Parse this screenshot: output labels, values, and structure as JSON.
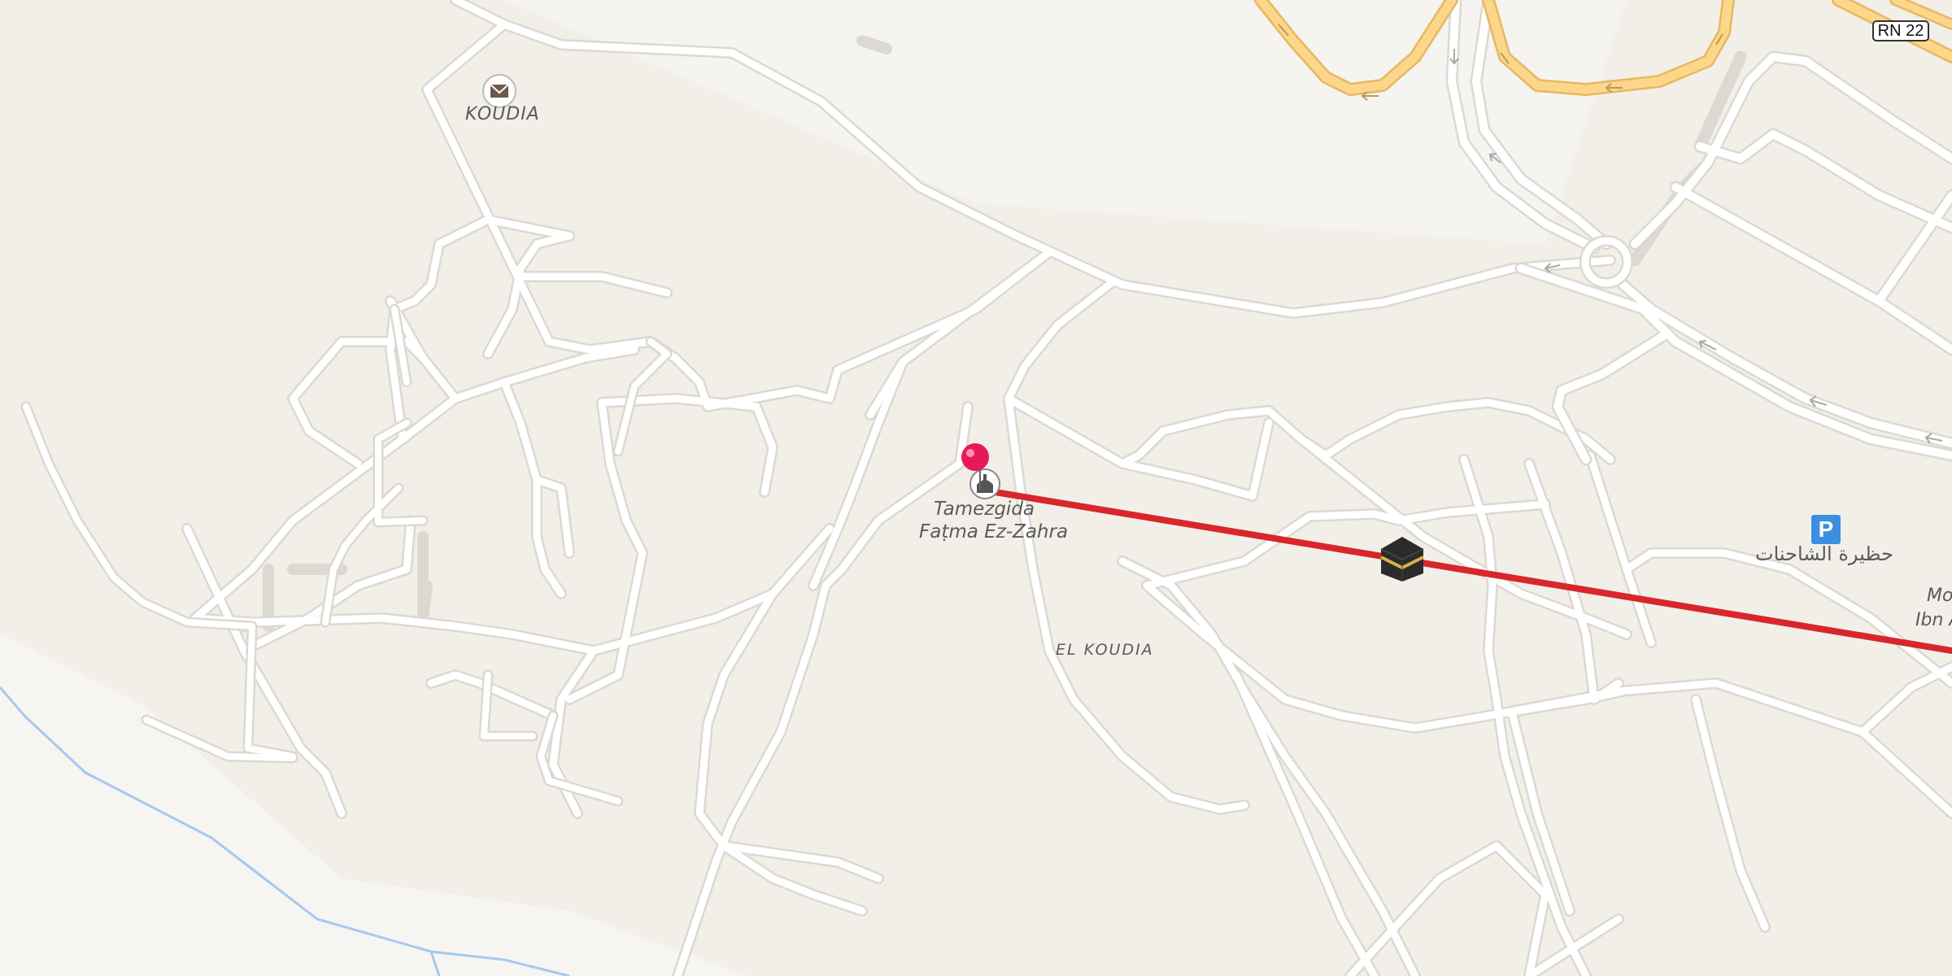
{
  "map": {
    "labels": {
      "koudia": "KOUDIA",
      "mosque_line1": "Tamezgida",
      "mosque_line2": "Faṭma Ez-Zahra",
      "el_koudia": "EL KOUDIA",
      "parking_name": "حظيرة الشاحنات",
      "cut_line1": "Mo",
      "cut_line2": "Ibn A"
    },
    "road_shield": "RN 22",
    "parking_symbol": "P",
    "icons": [
      "post-office-icon",
      "mosque-icon",
      "location-pin-icon",
      "kaaba-icon",
      "parking-icon"
    ],
    "colors": {
      "background": "#f2efe9",
      "road": "#ffffff",
      "road_casing": "#dcd8d2",
      "primary_road": "#fcd68a",
      "primary_road_casing": "#e8b860",
      "route_line": "#d9262b",
      "pin": "#e8195b",
      "water": "#a6c8f0",
      "parking": "#3b8fe0"
    }
  }
}
